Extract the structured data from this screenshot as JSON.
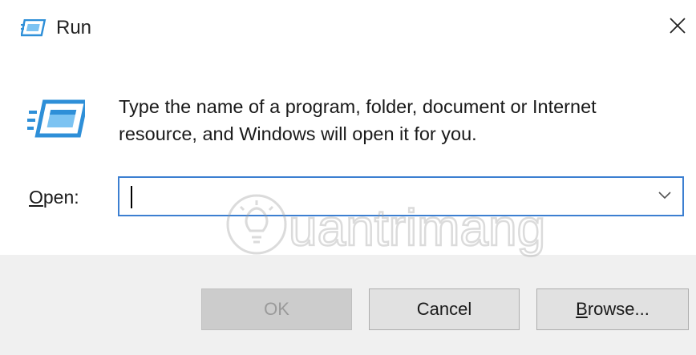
{
  "window": {
    "title": "Run",
    "title_icon": "run-icon",
    "close_icon": "close-icon"
  },
  "body": {
    "description_line1": "Type the name of a program, folder, document or Internet",
    "description_line2": "resource, and Windows will open it for you.",
    "open_label_mnemonic": "O",
    "open_label_rest": "pen:",
    "open_value": "",
    "dropdown_icon": "chevron-down-icon"
  },
  "buttons": {
    "ok": "OK",
    "cancel": "Cancel",
    "browse_mnemonic": "B",
    "browse_rest": "rowse..."
  },
  "watermark": {
    "text": "uantrimang",
    "icon": "lightbulb-icon"
  },
  "colors": {
    "focus_border": "#3c7fd1",
    "footer_bg": "#f0f0f0",
    "button_bg": "#e1e1e1",
    "icon_blue": "#2e8fd8"
  }
}
